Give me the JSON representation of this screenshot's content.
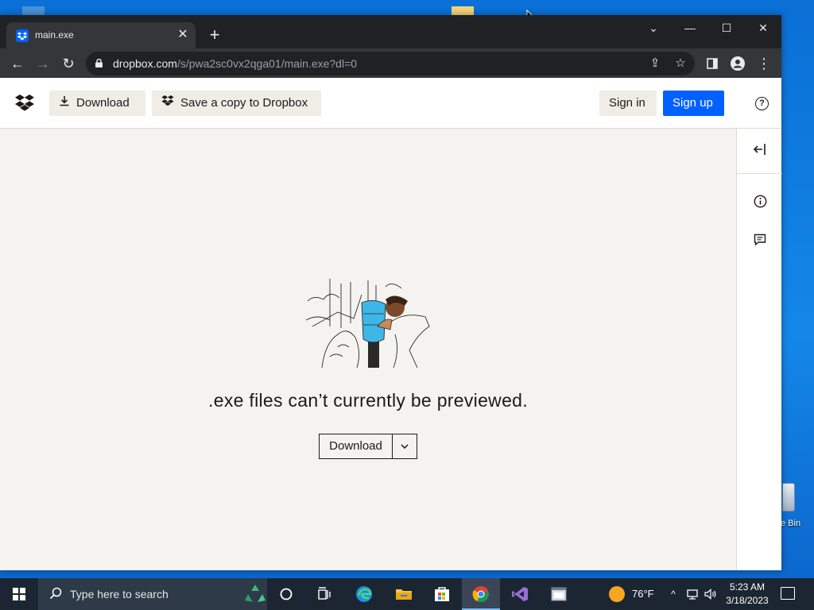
{
  "browser": {
    "tab_title": "main.exe",
    "url_domain": "dropbox.com",
    "url_path": "/s/pwa2sc0vx2qga01/main.exe?dl=0"
  },
  "header": {
    "download_label": "Download",
    "save_copy_label": "Save a copy to Dropbox",
    "sign_in_label": "Sign in",
    "sign_up_label": "Sign up"
  },
  "preview": {
    "message": ".exe files can’t currently be previewed.",
    "download_label": "Download"
  },
  "desktop": {
    "recycle_bin_label": "e Bin"
  },
  "taskbar": {
    "search_placeholder": "Type here to search",
    "temperature": "76°F",
    "time": "5:23 AM",
    "date": "3/18/2023"
  },
  "colors": {
    "dropbox_blue": "#0061fe",
    "preview_bg": "#f5f3ef",
    "illustration_blue": "#3fb6e8"
  },
  "icons": {
    "tab_favicon": "dropbox-icon",
    "rail": [
      "collapse-sidebar-icon",
      "info-icon",
      "comment-icon"
    ],
    "taskbar_apps": [
      "cortana-icon",
      "task-view-icon",
      "edge-icon",
      "file-explorer-icon",
      "store-icon",
      "chrome-icon",
      "visual-studio-icon",
      "app-window-icon"
    ]
  }
}
